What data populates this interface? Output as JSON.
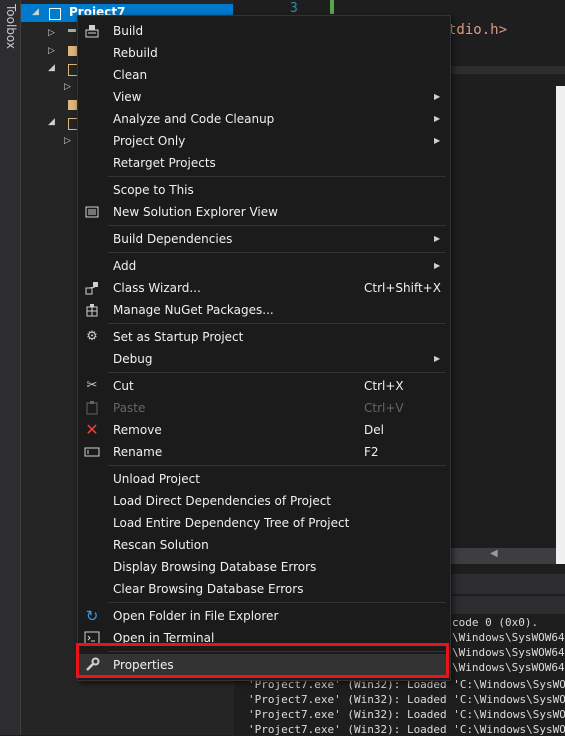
{
  "toolbox": {
    "label": "Toolbox"
  },
  "solution_explorer": {
    "project_name": "Project7"
  },
  "editor": {
    "line_number": "3",
    "code_fragment": "tdio.h>"
  },
  "output": {
    "lines": [
      "code 0 (0x0).",
      "\\Windows\\SysWOW64\\k",
      "\\Windows\\SysWOW64\\m",
      "\\Windows\\SysWOW64\\n",
      "'Project7.exe' (Win32): Loaded 'C:\\Windows\\SysWOW64\\c",
      "'Project7.exe' (Win32): Loaded 'C:\\Windows\\SysWOW64\\c",
      "'Project7.exe' (Win32): Loaded 'C:\\Windows\\SysWOW64\\b",
      "'Project7.exe' (Win32): Loaded 'C:\\Windows\\SysWOW64\\s"
    ]
  },
  "context_menu": {
    "items": [
      {
        "label": "Build",
        "icon": "build-icon"
      },
      {
        "label": "Rebuild"
      },
      {
        "label": "Clean"
      },
      {
        "label": "View",
        "submenu": true
      },
      {
        "label": "Analyze and Code Cleanup",
        "submenu": true
      },
      {
        "label": "Project Only",
        "submenu": true
      },
      {
        "label": "Retarget Projects"
      },
      {
        "label": "Scope to This"
      },
      {
        "label": "New Solution Explorer View",
        "icon": "new-view-icon"
      },
      {
        "label": "Build Dependencies",
        "submenu": true
      },
      {
        "label": "Add",
        "submenu": true
      },
      {
        "label": "Class Wizard...",
        "shortcut": "Ctrl+Shift+X",
        "icon": "class-wizard-icon"
      },
      {
        "label": "Manage NuGet Packages...",
        "icon": "nuget-icon"
      },
      {
        "label": "Set as Startup Project",
        "icon": "gear-icon"
      },
      {
        "label": "Debug",
        "submenu": true
      },
      {
        "label": "Cut",
        "shortcut": "Ctrl+X",
        "icon": "scissors-icon"
      },
      {
        "label": "Paste",
        "shortcut": "Ctrl+V",
        "icon": "clipboard-icon",
        "disabled": true
      },
      {
        "label": "Remove",
        "shortcut": "Del",
        "icon": "close-icon"
      },
      {
        "label": "Rename",
        "shortcut": "F2",
        "icon": "rename-icon"
      },
      {
        "label": "Unload Project"
      },
      {
        "label": "Load Direct Dependencies of Project"
      },
      {
        "label": "Load Entire Dependency Tree of Project"
      },
      {
        "label": "Rescan Solution"
      },
      {
        "label": "Display Browsing Database Errors"
      },
      {
        "label": "Clear Browsing Database Errors"
      },
      {
        "label": "Open Folder in File Explorer",
        "icon": "refresh-arrow-icon"
      },
      {
        "label": "Open in Terminal",
        "icon": "terminal-icon"
      },
      {
        "label": "Properties",
        "icon": "wrench-icon",
        "highlighted": true
      }
    ]
  },
  "colors": {
    "highlight_box": "#e8141a",
    "selection": "#007acc",
    "remove_icon": "#e8413c",
    "open_folder_icon": "#3b9ae1"
  }
}
